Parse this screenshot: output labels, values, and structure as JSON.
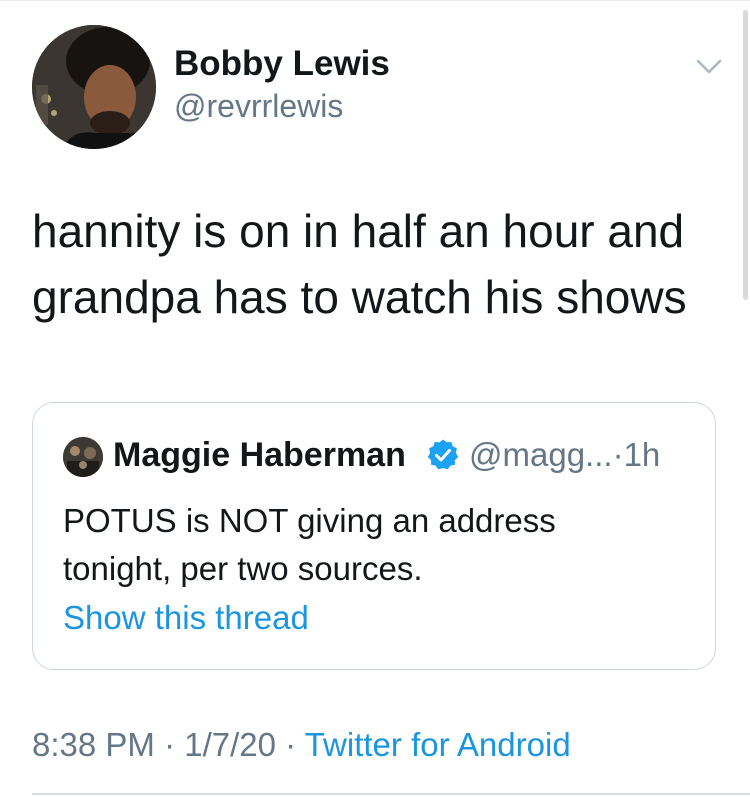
{
  "tweet": {
    "author": {
      "name": "Bobby Lewis",
      "handle": "@revrrlewis",
      "avatar_icon": "profile-photo"
    },
    "text_lines": [
      "hannity is on in half an hour and",
      "grandpa has to watch his shows"
    ],
    "menu_icon": "chevron-down-icon",
    "quoted": {
      "name": "Maggie Haberman",
      "verified_icon": "verified-badge-icon",
      "handle": "@magg...",
      "separator": "·",
      "time": "1h",
      "text_lines": [
        "POTUS is NOT giving an address",
        "tonight, per two sources."
      ],
      "thread_link": "Show this thread"
    },
    "meta": {
      "time": "8:38 PM",
      "separator1": " · ",
      "date": "1/7/20",
      "separator2": " · ",
      "source": "Twitter for Android"
    }
  },
  "colors": {
    "text": "#14171a",
    "secondary": "#657786",
    "link": "#1b95e0",
    "verified": "#1da1f2",
    "border": "#ccd6dd"
  }
}
